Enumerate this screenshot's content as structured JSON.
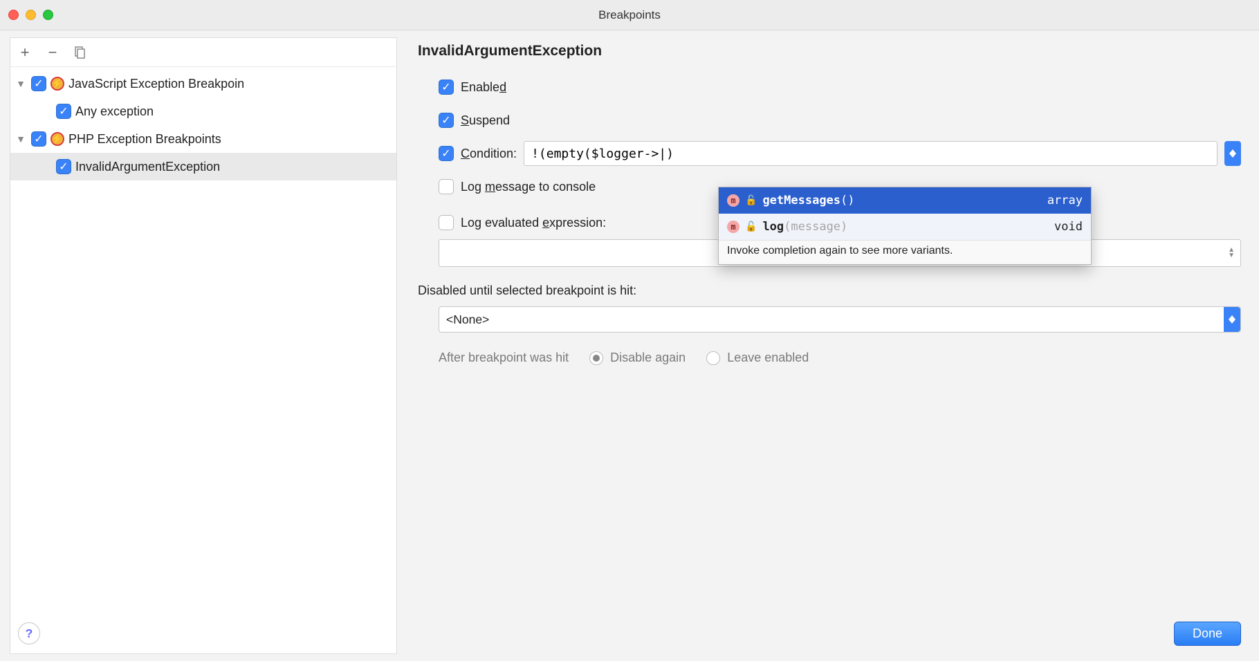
{
  "window": {
    "title": "Breakpoints"
  },
  "tree": {
    "add_tooltip": "+",
    "remove_tooltip": "−",
    "items": [
      {
        "label": "JavaScript Exception Breakpoin",
        "expandable": true,
        "checked": true,
        "bolt": true,
        "indent": 0
      },
      {
        "label": "Any exception",
        "expandable": false,
        "checked": true,
        "bolt": false,
        "indent": 1
      },
      {
        "label": "PHP Exception Breakpoints",
        "expandable": true,
        "checked": true,
        "bolt": true,
        "indent": 0
      },
      {
        "label": "InvalidArgumentException",
        "expandable": false,
        "checked": true,
        "bolt": false,
        "indent": 1,
        "selected": true
      }
    ]
  },
  "detail": {
    "title": "InvalidArgumentException",
    "enabled_label": "Enabled",
    "suspend_label": "Suspend",
    "condition_label": "Condition:",
    "condition_value": "!(empty($logger->|)",
    "log_console_label": "Log message to console",
    "log_expr_label": "Log evaluated expression:",
    "disabled_until_label": "Disabled until selected breakpoint is hit:",
    "none_value": "<None>",
    "after_hit_label": "After breakpoint was hit",
    "disable_again_label": "Disable again",
    "leave_enabled_label": "Leave enabled"
  },
  "completion": {
    "items": [
      {
        "name": "getMessages",
        "sig": "()",
        "type": "array",
        "selected": true
      },
      {
        "name": "log",
        "sig": "(message)",
        "type": "void",
        "dim_sig": true
      }
    ],
    "hint": "Invoke completion again to see more variants."
  },
  "footer": {
    "done_label": "Done"
  }
}
